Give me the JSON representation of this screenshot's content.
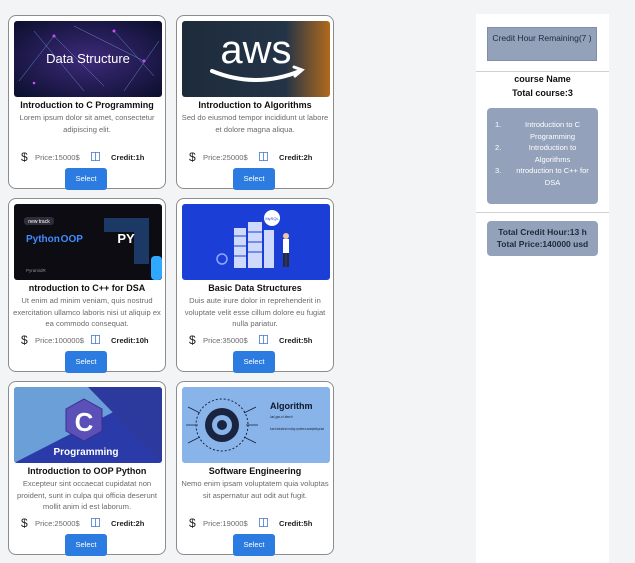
{
  "courses": [
    {
      "thumb_text": "Data Structure",
      "title": "Introduction to C Programming",
      "description": "Lorem ipsum dolor sit amet, consectetur adipiscing elit.",
      "price": "Price:15000$",
      "credit": "Credit:1h",
      "select_label": "Select"
    },
    {
      "thumb_text": "aws",
      "title": "Introduction to Algorithms",
      "description": "Sed do eiusmod tempor incididunt ut labore et dolore magna aliqua.",
      "price": "Price:25000$",
      "credit": "Credit:2h",
      "select_label": "Select"
    },
    {
      "thumb_text": "Python OOP",
      "thumb_badge": "new track",
      "thumb_py": "PY",
      "thumb_brand": "PyramidR",
      "title": "ntroduction to C++ for DSA",
      "description": "Ut enim ad minim veniam, quis nostrud exercitation ullamco laboris nisi ut aliquip ex ea commodo consequat.",
      "price": "Price:100000$",
      "credit": "Credit:10h",
      "select_label": "Select"
    },
    {
      "thumb_text": "MySQL",
      "title": "Basic Data Structures",
      "description": "Duis aute irure dolor in reprehenderit in voluptate velit esse cillum dolore eu fugiat nulla pariatur.",
      "price": "Price:35000$",
      "credit": "Credit:5h",
      "select_label": "Select"
    },
    {
      "thumb_text": "Programming",
      "thumb_letter": "C",
      "title": "Introduction to OOP Python",
      "description": "Excepteur sint occaecat cupidatat non proident, sunt in culpa qui officia deserunt mollit anim id est laborum.",
      "price": "Price:25000$",
      "credit": "Credit:2h",
      "select_label": "Select"
    },
    {
      "thumb_text": "Algorithm",
      "thumb_phon": "\\al-go-ri-thm\\",
      "thumb_def": "A set of instructions for solving a problem or accomplishing a task",
      "title": "Software Engineering",
      "description": "Nemo enim ipsam voluptatem quia voluptas sit aspernatur aut odit aut fugit.",
      "price": "Price:19000$",
      "credit": "Credit:5h",
      "select_label": "Select"
    }
  ],
  "cart": {
    "credit_hour_remaining": "Credit Hour Remaining(7 )",
    "course_name_label": "course Name",
    "total_course": "Total course:3",
    "items": [
      {
        "num": "1.",
        "name": "Introduction to C Programming"
      },
      {
        "num": "2.",
        "name": "Introduction to Algorithms"
      },
      {
        "num": "3.",
        "name": "ntroduction to C++ for DSA"
      }
    ],
    "total_credit_hour": "Total Credit Hour:13 h",
    "total_price": "Total Price:140000 usd"
  },
  "icons": {
    "dollar": "$",
    "book": "book-icon"
  },
  "colors": {
    "select_button": "#2b7be0",
    "cart_panel": "#93a1ba",
    "card_border": "#8c8c8c"
  }
}
